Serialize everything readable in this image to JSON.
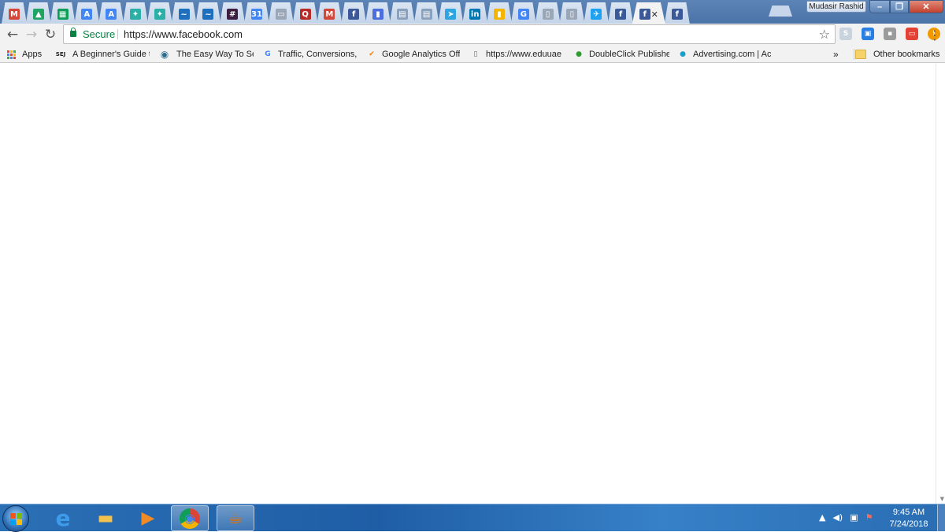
{
  "window": {
    "profile_name": "Mudasir Rashid",
    "min_glyph": "–",
    "max_glyph": "❐",
    "close_glyph": "✕"
  },
  "tabs": [
    {
      "icon": "gmail-icon",
      "glyph": "M",
      "color": "#d44638"
    },
    {
      "icon": "drive-icon",
      "glyph": "▲",
      "color": "#1fa463"
    },
    {
      "icon": "sheets-icon",
      "glyph": "▦",
      "color": "#0f9d58"
    },
    {
      "icon": "adwords-icon",
      "glyph": "A",
      "color": "#4285f4"
    },
    {
      "icon": "adwords-icon",
      "glyph": "A",
      "color": "#4285f4"
    },
    {
      "icon": "bird-icon",
      "glyph": "✦",
      "color": "#2bb0a8"
    },
    {
      "icon": "bird-icon",
      "glyph": "✦",
      "color": "#2bb0a8"
    },
    {
      "icon": "wave-icon",
      "glyph": "~",
      "color": "#1f6fbf"
    },
    {
      "icon": "wave-icon",
      "glyph": "~",
      "color": "#1f6fbf"
    },
    {
      "icon": "slack-icon",
      "glyph": "#",
      "color": "#3c1e40"
    },
    {
      "icon": "calendar-icon",
      "glyph": "31",
      "color": "#4285f4"
    },
    {
      "icon": "page-icon",
      "glyph": "▭",
      "color": "#9aa7b6"
    },
    {
      "icon": "quora-icon",
      "glyph": "Q",
      "color": "#b92b27"
    },
    {
      "icon": "gmail-icon",
      "glyph": "M",
      "color": "#d44638"
    },
    {
      "icon": "facebook-icon",
      "glyph": "f",
      "color": "#3b5998"
    },
    {
      "icon": "bookmark-icon",
      "glyph": "▮",
      "color": "#4a6fdc"
    },
    {
      "icon": "store-icon",
      "glyph": "▤",
      "color": "#8aa1bd"
    },
    {
      "icon": "store-icon",
      "glyph": "▤",
      "color": "#8aa1bd"
    },
    {
      "icon": "telegram-icon",
      "glyph": "➤",
      "color": "#2ca5e0"
    },
    {
      "icon": "linkedin-icon",
      "glyph": "in",
      "color": "#0077b5"
    },
    {
      "icon": "analytics-icon",
      "glyph": "▮",
      "color": "#f4b400"
    },
    {
      "icon": "google-icon",
      "glyph": "G",
      "color": "#4285f4"
    },
    {
      "icon": "document-icon",
      "glyph": "▯",
      "color": "#9aa7b6"
    },
    {
      "icon": "document-icon",
      "glyph": "▯",
      "color": "#9aa7b6"
    },
    {
      "icon": "twitter-icon",
      "glyph": "✈",
      "color": "#1da1f2"
    },
    {
      "icon": "facebook-icon",
      "glyph": "f",
      "color": "#3b5998"
    },
    {
      "icon": "facebook-icon",
      "glyph": "f",
      "color": "#3b5998",
      "active": true
    },
    {
      "icon": "facebook-icon",
      "glyph": "f",
      "color": "#3b5998"
    }
  ],
  "tabs_active_close": "✕",
  "toolbar": {
    "back_glyph": "←",
    "forward_glyph": "→",
    "reload_glyph": "↻",
    "secure_label": "Secure",
    "url": "https://www.facebook.com",
    "star_glyph": "☆",
    "menu_glyph": "⋮"
  },
  "extensions": [
    {
      "icon": "skype-icon",
      "glyph": "S",
      "color": "#c8d3dd"
    },
    {
      "icon": "extension-blue-icon",
      "glyph": "▣",
      "color": "#2a7de1"
    },
    {
      "icon": "extension-gray-icon",
      "glyph": "▪",
      "color": "#9b9b9b"
    },
    {
      "icon": "cast-icon",
      "glyph": "▭",
      "color": "#e34133"
    },
    {
      "icon": "alert-icon",
      "glyph": "!",
      "color": "#f29900"
    }
  ],
  "bookmarks": {
    "apps_label": "Apps",
    "items": [
      {
        "label": "A Beginner's Guide t",
        "icon": "sej-icon",
        "glyph": "SEJ",
        "color": "#222"
      },
      {
        "label": "The Easy Way To Se",
        "icon": "owl-icon",
        "glyph": "◉",
        "color": "#2c6b8f"
      },
      {
        "label": "Traffic, Conversions,",
        "icon": "google-icon",
        "glyph": "G",
        "color": "#4285f4"
      },
      {
        "label": "Google Analytics Off",
        "icon": "analytics-icon",
        "glyph": "✔",
        "color": "#f57c00"
      },
      {
        "label": "https://www.eduuae",
        "icon": "page-icon",
        "glyph": "▯",
        "color": "#666"
      },
      {
        "label": "DoubleClick Publishe",
        "icon": "doubleclick-icon",
        "glyph": "●",
        "color": "#2e9c2e"
      },
      {
        "label": "Advertising.com | Ac",
        "icon": "advertising-icon",
        "glyph": "●",
        "color": "#1aa0c8"
      }
    ],
    "overflow_glyph": "»",
    "other_label": "Other bookmarks"
  },
  "taskbar": {
    "apps": [
      {
        "icon": "internet-explorer-icon",
        "glyph": "e",
        "color": "#3d9be9",
        "open": false
      },
      {
        "icon": "file-explorer-icon",
        "glyph": "▬",
        "color": "#f2c14e",
        "open": false
      },
      {
        "icon": "media-player-icon",
        "glyph": "▶",
        "color": "#f08a24",
        "open": false
      },
      {
        "icon": "chrome-icon",
        "glyph": "◉",
        "color": "#db4437",
        "open": true
      },
      {
        "icon": "java-icon",
        "glyph": "☕",
        "color": "#e76f00",
        "open": true
      }
    ],
    "tray": {
      "show_hidden_glyph": "▲",
      "volume_glyph": "◀)",
      "network_glyph": "▣",
      "action_center_glyph": "⚑"
    },
    "clock": {
      "time": "9:45 AM",
      "date": "7/24/2018"
    }
  }
}
